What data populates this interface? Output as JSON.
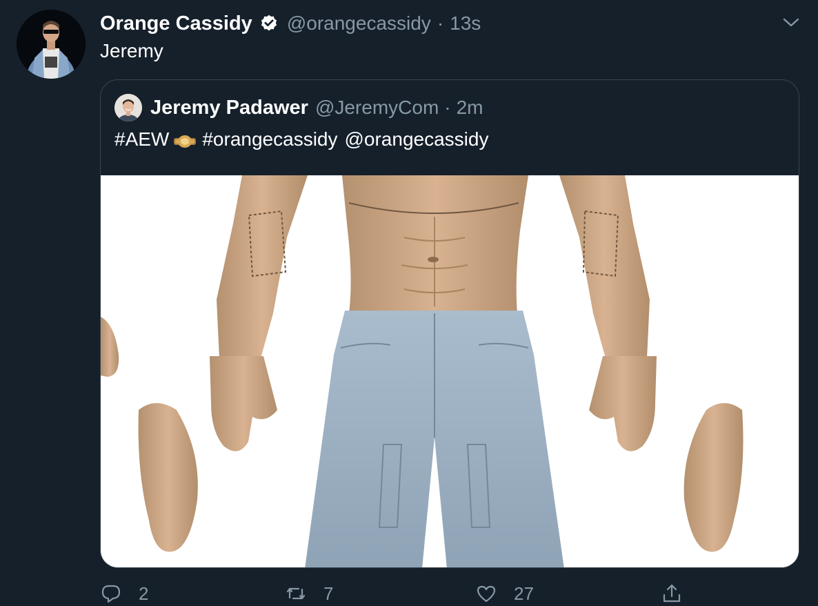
{
  "tweet": {
    "author": {
      "display_name": "Orange Cassidy",
      "handle": "@orangecassidy",
      "verified_icon": "verified-badge-icon"
    },
    "separator": "·",
    "time": "13s",
    "text": "Jeremy",
    "menu_icon": "chevron-down-icon"
  },
  "quote": {
    "author": {
      "display_name": "Jeremy Padawer",
      "handle": "@JeremyCom"
    },
    "separator": "·",
    "time": "2m",
    "hashtag_1": "#AEW",
    "emoji_icon": "championship-belt-icon",
    "hashtag_2": "#orangecassidy",
    "mention": "@orangecassidy",
    "media": {
      "type": "image",
      "subject": "3D sculpt of a muscular torso, arms and denim shorts"
    }
  },
  "actions": {
    "reply": {
      "icon": "reply-icon",
      "count": "2"
    },
    "retweet": {
      "icon": "retweet-icon",
      "count": "7"
    },
    "like": {
      "icon": "heart-icon",
      "count": "27"
    },
    "share": {
      "icon": "share-icon"
    }
  },
  "colors": {
    "background": "#15202b",
    "secondary_text": "#8899a6",
    "border": "#38444d",
    "primary_text": "#ffffff"
  }
}
